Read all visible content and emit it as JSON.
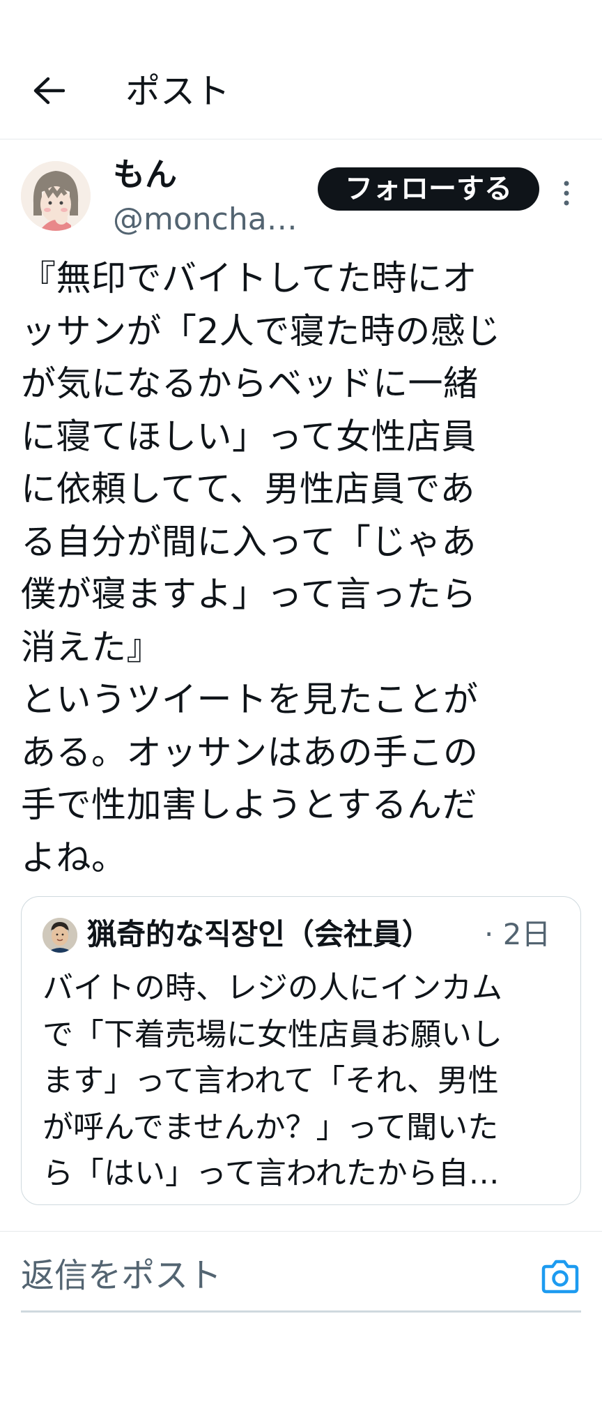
{
  "header": {
    "title": "ポスト",
    "back_icon": "arrow-left-icon"
  },
  "author": {
    "display_name": "もん",
    "handle": "@moncha…",
    "follow_label": "フォローする",
    "more_icon": "more-vertical-icon"
  },
  "tweet": {
    "lines": [
      "『無印でバイトしてた時にオ",
      "ッサンが「2人で寝た時の感じ",
      "が気になるからベッドに一緒",
      "に寝てほしい」って女性店員",
      "に依頼してて、男性店員であ",
      "る自分が間に入って「じゃあ",
      "僕が寝ますよ」って言ったら",
      "消えた』",
      "というツイートを見たことが",
      "ある。オッサンはあの手この",
      "手で性加害しようとするんだ",
      "よね。"
    ]
  },
  "quote": {
    "name": "猟奇的な직장인（会社員）",
    "time": "· 2日",
    "lines": [
      "バイトの時、レジの人にインカム",
      "で「下着売場に女性店員お願いし",
      "ます」って言われて「それ、男性",
      "が呼んでませんか？」って聞いた",
      "ら「はい」って言われたから自…"
    ]
  },
  "reply": {
    "placeholder": "返信をポスト",
    "camera_icon": "camera-icon"
  },
  "colors": {
    "text": "#0f1419",
    "secondary": "#536471",
    "accent": "#1d9bf0",
    "border": "#cfd9de",
    "follow_bg": "#0f1419"
  }
}
